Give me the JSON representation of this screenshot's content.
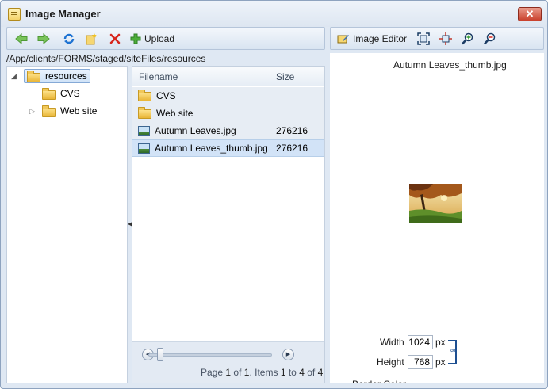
{
  "window": {
    "title": "Image Manager",
    "close_glyph": "✕"
  },
  "toolbar": {
    "back_icon": "arrow-left-icon",
    "forward_icon": "arrow-right-icon",
    "refresh_icon": "refresh-icon",
    "new_folder_icon": "new-folder-icon",
    "delete_icon": "delete-icon",
    "upload_label": "Upload"
  },
  "editor_toolbar": {
    "image_editor_label": "Image Editor",
    "best_fit_icon": "best-fit-icon",
    "actual_size_icon": "actual-size-icon",
    "zoom_in_icon": "zoom-in-icon",
    "zoom_out_icon": "zoom-out-icon"
  },
  "path": "/App/clients/FORMS/staged/siteFiles/resources",
  "tree": {
    "root": {
      "label": "resources",
      "expanded": true,
      "selected": true
    },
    "children": [
      {
        "label": "CVS",
        "has_children": false
      },
      {
        "label": "Web site",
        "has_children": true
      }
    ]
  },
  "grid": {
    "columns": {
      "filename": "Filename",
      "size": "Size"
    },
    "rows": [
      {
        "type": "folder",
        "name": "CVS",
        "size": ""
      },
      {
        "type": "folder",
        "name": "Web site",
        "size": ""
      },
      {
        "type": "image",
        "name": "Autumn Leaves.jpg",
        "size": "276216"
      },
      {
        "type": "image",
        "name": "Autumn Leaves_thumb.jpg",
        "size": "276216",
        "selected": true
      }
    ],
    "pager": {
      "page_word": "Page",
      "page": "1",
      "of_word": "of",
      "total_pages": "1",
      "items_word": "Items",
      "item_from": "1",
      "to_word": "to",
      "item_to": "4",
      "of_word2": "of",
      "total_items": "4"
    },
    "slider_position": 0.05
  },
  "preview": {
    "filename": "Autumn Leaves_thumb.jpg",
    "width_label": "Width",
    "width_value": "1024",
    "width_unit": "px",
    "height_label": "Height",
    "height_value": "768",
    "height_unit": "px",
    "cutoff_label": "Border Color",
    "link_icon": "chain-link-icon"
  },
  "colors": {
    "accent": "#1d4f91",
    "selection": "#d2e3f7",
    "delete_red": "#d7261d",
    "nav_green": "#6cc24a",
    "refresh_blue": "#1f73d2"
  }
}
